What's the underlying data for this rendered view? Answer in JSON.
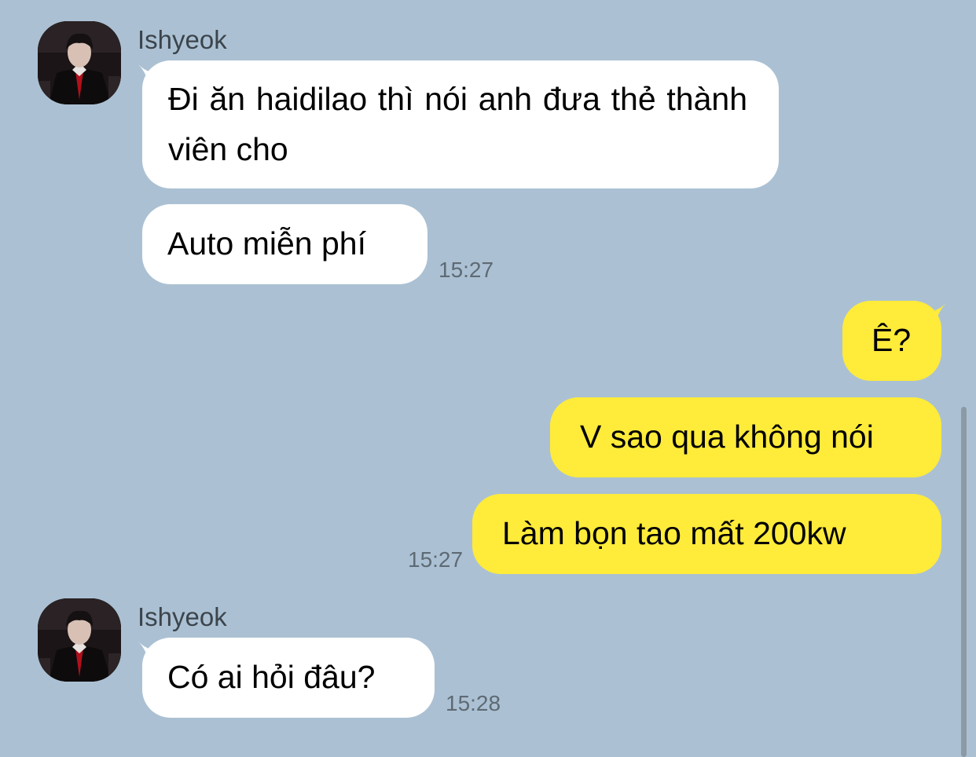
{
  "colors": {
    "background": "#abc1d3",
    "incoming_bubble": "#ffffff",
    "outgoing_bubble": "#ffeb3a"
  },
  "groups": [
    {
      "sender": "Ishyeok",
      "messages": [
        "Đi ăn haidilao thì nói anh đưa thẻ thành viên cho",
        "Auto miễn phí"
      ],
      "time": "15:27"
    },
    {
      "messages": [
        "Ê?",
        "V sao qua không nói",
        "Làm bọn tao mất 200kw"
      ],
      "time": "15:27"
    },
    {
      "sender": "Ishyeok",
      "messages": [
        "Có ai hỏi đâu?"
      ],
      "time": "15:28"
    }
  ]
}
